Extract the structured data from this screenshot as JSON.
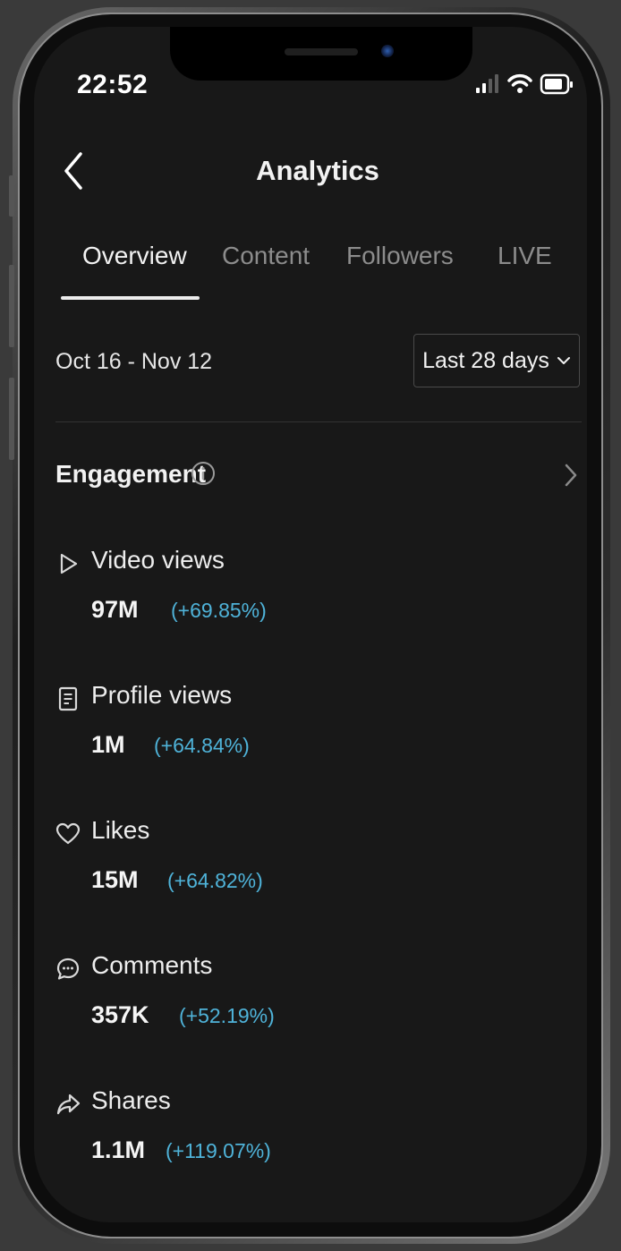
{
  "status_bar": {
    "time": "22:52",
    "icons": [
      "signal-icon",
      "wifi-icon",
      "battery-icon"
    ]
  },
  "header": {
    "title": "Analytics",
    "back_icon": "chevron-left-icon"
  },
  "tabs": [
    {
      "label": "Overview",
      "active": true
    },
    {
      "label": "Content",
      "active": false
    },
    {
      "label": "Followers",
      "active": false
    },
    {
      "label": "LIVE",
      "active": false
    }
  ],
  "filter": {
    "date_range": "Oct 16 - Nov 12",
    "period": "Last 28 days",
    "dropdown_icon": "chevron-down-icon"
  },
  "engagement": {
    "title": "Engagement",
    "info_icon": "info-icon",
    "nav_icon": "chevron-right-icon",
    "metrics": [
      {
        "label": "Video views",
        "value": "97M",
        "change": "(+69.85%)",
        "icon": "play-outline-icon"
      },
      {
        "label": "Profile views",
        "value": "1M",
        "change": "(+64.84%)",
        "icon": "profile-doc-icon"
      },
      {
        "label": "Likes",
        "value": "15M",
        "change": "(+64.82%)",
        "icon": "heart-outline-icon"
      },
      {
        "label": "Comments",
        "value": "357K",
        "change": "(+52.19%)",
        "icon": "comment-bubble-icon"
      },
      {
        "label": "Shares",
        "value": "1.1M",
        "change": "(+119.07%)",
        "icon": "share-arrow-icon"
      }
    ]
  },
  "colors": {
    "background": "#181818",
    "text_primary": "#f2f2f2",
    "text_inactive": "#8c8c8c",
    "change_positive": "#4fb3d9"
  }
}
